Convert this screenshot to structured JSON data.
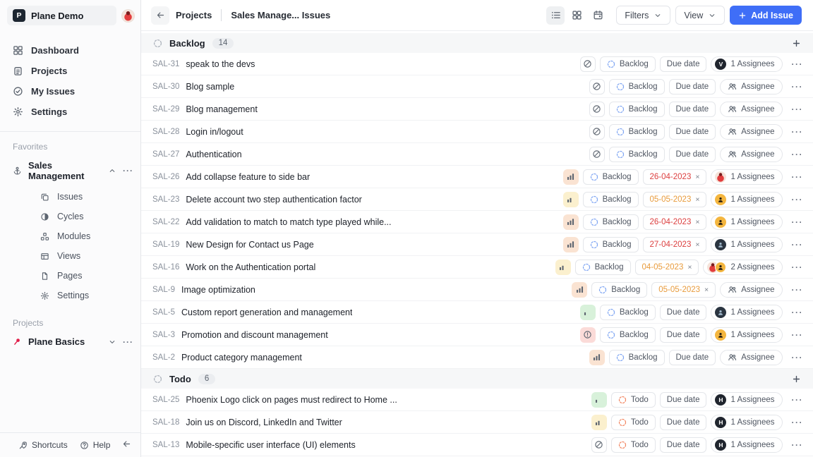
{
  "colors": {
    "accent_blue": "#3f6ef7",
    "date_overdue_red": "#dc4040",
    "date_upcoming_orange": "#e89b3c",
    "backlog_state_icon": "#7da4f2",
    "todo_state_icon": "#f2845f",
    "priority_high": "#ed8336",
    "priority_high_bg": "#fae3d2",
    "priority_medium": "#d9a31c",
    "priority_medium_bg": "#fbf0ce",
    "priority_low": "#52b365",
    "priority_low_bg": "#d8f1da",
    "priority_urgent": "#ef5350",
    "priority_urgent_bg": "#fbdbd8"
  },
  "glyphs": {
    "menu": "···",
    "plus": "+",
    "close": "×"
  },
  "sidebar": {
    "workspace_initial": "P",
    "workspace_name": "Plane Demo",
    "user_avatar": "phoenix-mascot-avatar",
    "nav_items": [
      {
        "label": "Dashboard",
        "icon": "dashboard-grid-icon"
      },
      {
        "label": "Projects",
        "icon": "projects-clipboard-icon"
      },
      {
        "label": "My Issues",
        "icon": "check-circle-icon"
      },
      {
        "label": "Settings",
        "icon": "gear-icon"
      }
    ],
    "favorites_label": "Favorites",
    "favorite_project": {
      "name": "Sales Management",
      "icon": "anchor-icon",
      "expanded": true,
      "children": [
        {
          "label": "Issues",
          "icon": "issues-stack-icon"
        },
        {
          "label": "Cycles",
          "icon": "contrast-circle-icon"
        },
        {
          "label": "Modules",
          "icon": "modules-blocks-icon"
        },
        {
          "label": "Views",
          "icon": "table-icon"
        },
        {
          "label": "Pages",
          "icon": "page-file-icon"
        },
        {
          "label": "Settings",
          "icon": "gear-icon"
        }
      ]
    },
    "projects_label": "Projects",
    "project_item": {
      "name": "Plane Basics",
      "icon": "pin-icon",
      "expanded": false
    },
    "footer": {
      "shortcuts_label": "Shortcuts",
      "help_label": "Help"
    }
  },
  "topbar": {
    "breadcrumb_items": [
      "Projects",
      "Sales Manage... Issues"
    ],
    "view_modes": [
      "list-view-icon",
      "kanban-view-icon",
      "calendar-view-icon"
    ],
    "active_view": "list",
    "filters_label": "Filters",
    "view_label": "View",
    "add_issue_label": "Add Issue"
  },
  "issue_groups": [
    {
      "name": "Backlog",
      "count": "14",
      "state": "backlog",
      "rows": [
        {
          "id": "SAL-31",
          "title": "speak to the devs",
          "priority": "none",
          "state_label": "Backlog",
          "due": {
            "text": "Due date"
          },
          "assignees": {
            "label": "1 Assignees",
            "avatars": [
              "letter:V"
            ]
          }
        },
        {
          "id": "SAL-30",
          "title": "Blog sample",
          "priority": "none",
          "state_label": "Backlog",
          "due": {
            "text": "Due date"
          },
          "assignees": {
            "label": "Assignee",
            "avatars": []
          }
        },
        {
          "id": "SAL-29",
          "title": "Blog management",
          "priority": "none",
          "state_label": "Backlog",
          "due": {
            "text": "Due date"
          },
          "assignees": {
            "label": "Assignee",
            "avatars": []
          }
        },
        {
          "id": "SAL-28",
          "title": "Login in/logout",
          "priority": "none",
          "state_label": "Backlog",
          "due": {
            "text": "Due date"
          },
          "assignees": {
            "label": "Assignee",
            "avatars": []
          }
        },
        {
          "id": "SAL-27",
          "title": "Authentication",
          "priority": "none",
          "state_label": "Backlog",
          "due": {
            "text": "Due date"
          },
          "assignees": {
            "label": "Assignee",
            "avatars": []
          }
        },
        {
          "id": "SAL-26",
          "title": "Add collapse feature to side bar",
          "priority": "high",
          "state_label": "Backlog",
          "due": {
            "text": "26-04-2023",
            "color": "red"
          },
          "assignees": {
            "label": "1 Assignees",
            "avatars": [
              "phoenix"
            ]
          }
        },
        {
          "id": "SAL-23",
          "title": "Delete account two step authentication factor",
          "priority": "medium",
          "state_label": "Backlog",
          "due": {
            "text": "05-05-2023",
            "color": "orange"
          },
          "assignees": {
            "label": "1 Assignees",
            "avatars": [
              "yellow"
            ]
          }
        },
        {
          "id": "SAL-22",
          "title": "Add validation to match to match type played while...",
          "priority": "high",
          "state_label": "Backlog",
          "due": {
            "text": "26-04-2023",
            "color": "red"
          },
          "assignees": {
            "label": "1 Assignees",
            "avatars": [
              "yellow"
            ]
          }
        },
        {
          "id": "SAL-19",
          "title": "New Design for Contact us Page",
          "priority": "high",
          "state_label": "Backlog",
          "due": {
            "text": "27-04-2023",
            "color": "red"
          },
          "assignees": {
            "label": "1 Assignees",
            "avatars": [
              "darkimg"
            ]
          }
        },
        {
          "id": "SAL-16",
          "title": "Work on the Authentication portal",
          "priority": "medium",
          "state_label": "Backlog",
          "due": {
            "text": "04-05-2023",
            "color": "orange"
          },
          "assignees": {
            "label": "2 Assignees",
            "avatars": [
              "phoenix",
              "yellow"
            ]
          }
        },
        {
          "id": "SAL-9",
          "title": "Image optimization",
          "priority": "high",
          "state_label": "Backlog",
          "due": {
            "text": "05-05-2023",
            "color": "orange"
          },
          "assignees": {
            "label": "Assignee",
            "avatars": []
          }
        },
        {
          "id": "SAL-5",
          "title": "Custom report generation and management",
          "priority": "low",
          "state_label": "Backlog",
          "due": {
            "text": "Due date"
          },
          "assignees": {
            "label": "1 Assignees",
            "avatars": [
              "darkimg"
            ]
          }
        },
        {
          "id": "SAL-3",
          "title": "Promotion and discount management",
          "priority": "urgent",
          "state_label": "Backlog",
          "due": {
            "text": "Due date"
          },
          "assignees": {
            "label": "1 Assignees",
            "avatars": [
              "yellow"
            ]
          }
        },
        {
          "id": "SAL-2",
          "title": "Product category management",
          "priority": "high",
          "state_label": "Backlog",
          "due": {
            "text": "Due date"
          },
          "assignees": {
            "label": "Assignee",
            "avatars": []
          }
        }
      ]
    },
    {
      "name": "Todo",
      "count": "6",
      "state": "todo",
      "rows": [
        {
          "id": "SAL-25",
          "title": "Phoenix Logo click on pages must redirect to Home ...",
          "priority": "low",
          "state_label": "Todo",
          "due": {
            "text": "Due date"
          },
          "assignees": {
            "label": "1 Assignees",
            "avatars": [
              "letter:H"
            ]
          }
        },
        {
          "id": "SAL-18",
          "title": "Join us on Discord, LinkedIn and Twitter",
          "priority": "medium",
          "state_label": "Todo",
          "due": {
            "text": "Due date"
          },
          "assignees": {
            "label": "1 Assignees",
            "avatars": [
              "letter:H"
            ]
          }
        },
        {
          "id": "SAL-13",
          "title": "Mobile-specific user interface (UI) elements",
          "priority": "none",
          "state_label": "Todo",
          "due": {
            "text": "Due date"
          },
          "assignees": {
            "label": "1 Assignees",
            "avatars": [
              "letter:H"
            ]
          }
        }
      ]
    }
  ]
}
